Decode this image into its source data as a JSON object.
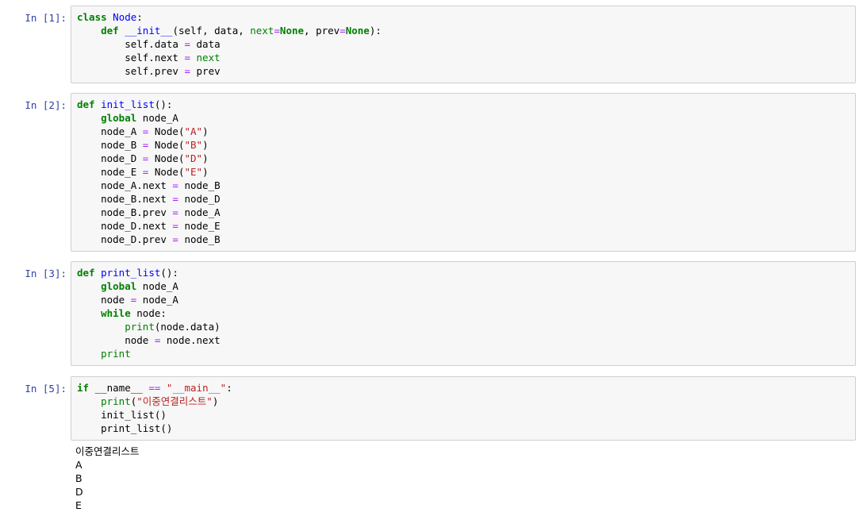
{
  "cells": [
    {
      "prompt": "In [1]:",
      "lines": [
        [
          {
            "t": "class",
            "c": "kw"
          },
          {
            "t": " "
          },
          {
            "t": "Node",
            "c": "fn"
          },
          {
            "t": ":"
          }
        ],
        [
          {
            "t": "    "
          },
          {
            "t": "def",
            "c": "kw"
          },
          {
            "t": " "
          },
          {
            "t": "__init__",
            "c": "fn"
          },
          {
            "t": "(self, data, "
          },
          {
            "t": "next",
            "c": "bi"
          },
          {
            "t": "=",
            "c": "op"
          },
          {
            "t": "None",
            "c": "kw"
          },
          {
            "t": ", prev"
          },
          {
            "t": "=",
            "c": "op"
          },
          {
            "t": "None",
            "c": "kw"
          },
          {
            "t": "):"
          }
        ],
        [
          {
            "t": "        self.data "
          },
          {
            "t": "=",
            "c": "op"
          },
          {
            "t": " data"
          }
        ],
        [
          {
            "t": "        self.next "
          },
          {
            "t": "=",
            "c": "op"
          },
          {
            "t": " "
          },
          {
            "t": "next",
            "c": "bi"
          }
        ],
        [
          {
            "t": "        self.prev "
          },
          {
            "t": "=",
            "c": "op"
          },
          {
            "t": " prev"
          }
        ]
      ]
    },
    {
      "prompt": "In [2]:",
      "lines": [
        [
          {
            "t": "def",
            "c": "kw"
          },
          {
            "t": " "
          },
          {
            "t": "init_list",
            "c": "fn"
          },
          {
            "t": "():"
          }
        ],
        [
          {
            "t": "    "
          },
          {
            "t": "global",
            "c": "kw"
          },
          {
            "t": " node_A"
          }
        ],
        [
          {
            "t": "    node_A "
          },
          {
            "t": "=",
            "c": "op"
          },
          {
            "t": " Node("
          },
          {
            "t": "\"A\"",
            "c": "st"
          },
          {
            "t": ")"
          }
        ],
        [
          {
            "t": "    node_B "
          },
          {
            "t": "=",
            "c": "op"
          },
          {
            "t": " Node("
          },
          {
            "t": "\"B\"",
            "c": "st"
          },
          {
            "t": ")"
          }
        ],
        [
          {
            "t": "    node_D "
          },
          {
            "t": "=",
            "c": "op"
          },
          {
            "t": " Node("
          },
          {
            "t": "\"D\"",
            "c": "st"
          },
          {
            "t": ")"
          }
        ],
        [
          {
            "t": "    node_E "
          },
          {
            "t": "=",
            "c": "op"
          },
          {
            "t": " Node("
          },
          {
            "t": "\"E\"",
            "c": "st"
          },
          {
            "t": ")"
          }
        ],
        [
          {
            "t": "    node_A.next "
          },
          {
            "t": "=",
            "c": "op"
          },
          {
            "t": " node_B"
          }
        ],
        [
          {
            "t": "    node_B.next "
          },
          {
            "t": "=",
            "c": "op"
          },
          {
            "t": " node_D"
          }
        ],
        [
          {
            "t": "    node_B.prev "
          },
          {
            "t": "=",
            "c": "op"
          },
          {
            "t": " node_A"
          }
        ],
        [
          {
            "t": "    node_D.next "
          },
          {
            "t": "=",
            "c": "op"
          },
          {
            "t": " node_E"
          }
        ],
        [
          {
            "t": "    node_D.prev "
          },
          {
            "t": "=",
            "c": "op"
          },
          {
            "t": " node_B"
          }
        ]
      ]
    },
    {
      "prompt": "In [3]:",
      "lines": [
        [
          {
            "t": "def",
            "c": "kw"
          },
          {
            "t": " "
          },
          {
            "t": "print_list",
            "c": "fn"
          },
          {
            "t": "():"
          }
        ],
        [
          {
            "t": "    "
          },
          {
            "t": "global",
            "c": "kw"
          },
          {
            "t": " node_A"
          }
        ],
        [
          {
            "t": "    node "
          },
          {
            "t": "=",
            "c": "op"
          },
          {
            "t": " node_A"
          }
        ],
        [
          {
            "t": "    "
          },
          {
            "t": "while",
            "c": "kw"
          },
          {
            "t": " node:"
          }
        ],
        [
          {
            "t": "        "
          },
          {
            "t": "print",
            "c": "bi"
          },
          {
            "t": "(node.data)"
          }
        ],
        [
          {
            "t": "        node "
          },
          {
            "t": "=",
            "c": "op"
          },
          {
            "t": " node.next"
          }
        ],
        [
          {
            "t": "    "
          },
          {
            "t": "print",
            "c": "bi"
          }
        ]
      ]
    },
    {
      "prompt": "In [5]:",
      "lines": [
        [
          {
            "t": "if",
            "c": "kw"
          },
          {
            "t": " __name__ "
          },
          {
            "t": "==",
            "c": "op"
          },
          {
            "t": " "
          },
          {
            "t": "\"__main__\"",
            "c": "st"
          },
          {
            "t": ":"
          }
        ],
        [
          {
            "t": "    "
          },
          {
            "t": "print",
            "c": "bi"
          },
          {
            "t": "("
          },
          {
            "t": "\"이중연결리스트\"",
            "c": "st"
          },
          {
            "t": ")"
          }
        ],
        [
          {
            "t": "    init_list()"
          }
        ],
        [
          {
            "t": "    print_list()"
          }
        ]
      ],
      "output": [
        "이중연결리스트",
        "A",
        "B",
        "D",
        "E"
      ]
    }
  ]
}
